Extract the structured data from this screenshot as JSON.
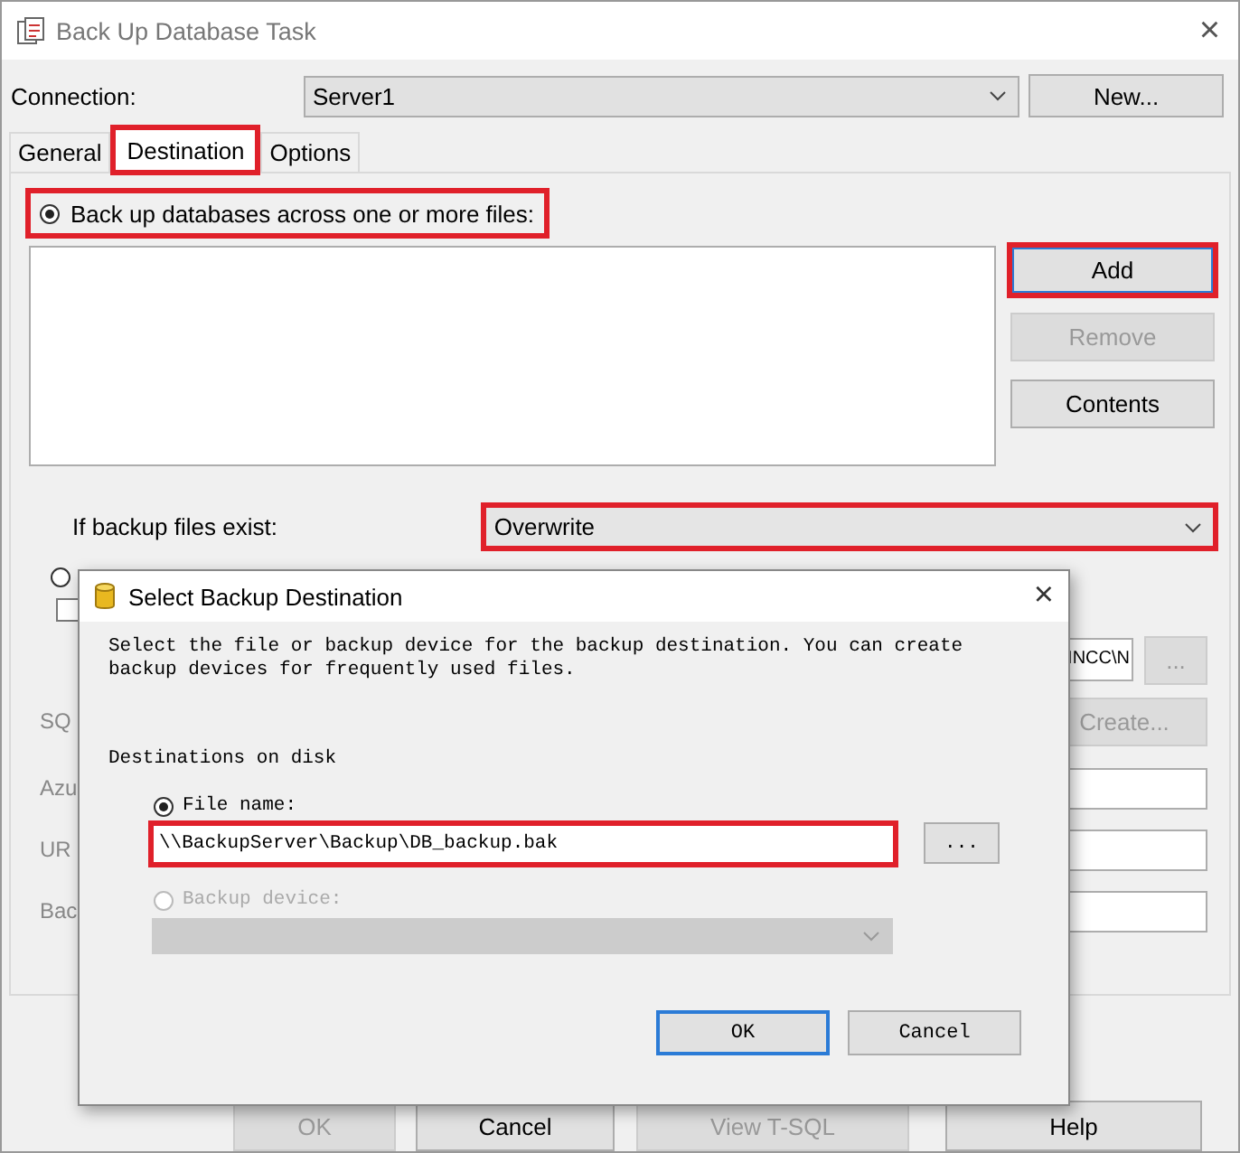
{
  "window": {
    "title": "Back Up Database Task",
    "close": "×"
  },
  "connection": {
    "label": "Connection:",
    "value": "Server1",
    "button": "New..."
  },
  "tabs": [
    {
      "label": "General",
      "selected": false,
      "highlighted": false
    },
    {
      "label": "Destination",
      "selected": true,
      "highlighted": true
    },
    {
      "label": "Options",
      "selected": false,
      "highlighted": false
    }
  ],
  "destination": {
    "label": "Back up databases across one or more files:",
    "selected": true,
    "highlighted": true
  },
  "file_buttons": [
    {
      "label": "Add",
      "disabled": false,
      "highlighted": true
    },
    {
      "label": "Remove",
      "disabled": true,
      "highlighted": false
    },
    {
      "label": "Contents",
      "disabled": false,
      "highlighted": false
    }
  ],
  "if_exists": {
    "label": "If backup files exist:",
    "value": "Overwrite",
    "highlighted": true
  },
  "second_option": {
    "selected": false
  },
  "create_folder": {
    "checked": false
  },
  "folder": {
    "value": "INCC\\N",
    "button": "...",
    "button_disabled": true
  },
  "partial_rows": [
    {
      "kind": "button",
      "label": "SQ",
      "button": "Create...",
      "disabled": true
    },
    {
      "kind": "field",
      "label": "Azu"
    },
    {
      "kind": "field",
      "label": "UR"
    },
    {
      "kind": "field",
      "label": "Bac"
    }
  ],
  "footer_buttons": [
    {
      "label": "OK",
      "disabled": true
    },
    {
      "label": "Cancel",
      "disabled": false
    },
    {
      "label": "View T-SQL",
      "disabled": true
    },
    {
      "label": "Help",
      "disabled": false
    }
  ],
  "dialog": {
    "title": "Select Backup Destination",
    "close": "×",
    "description": "Select the file or backup device for the backup destination. You can create backup devices for frequently used files.",
    "section": "Destinations on disk",
    "file_option": {
      "label": "File name:",
      "selected": true,
      "disabled": false
    },
    "file_value": "\\\\BackupServer\\Backup\\DB_backup.bak",
    "file_highlighted": true,
    "browse": "...",
    "device_option": {
      "label": "Backup device:",
      "selected": false,
      "disabled": true
    },
    "buttons": [
      {
        "label": "OK",
        "default": true
      },
      {
        "label": "Cancel",
        "default": false
      }
    ]
  }
}
